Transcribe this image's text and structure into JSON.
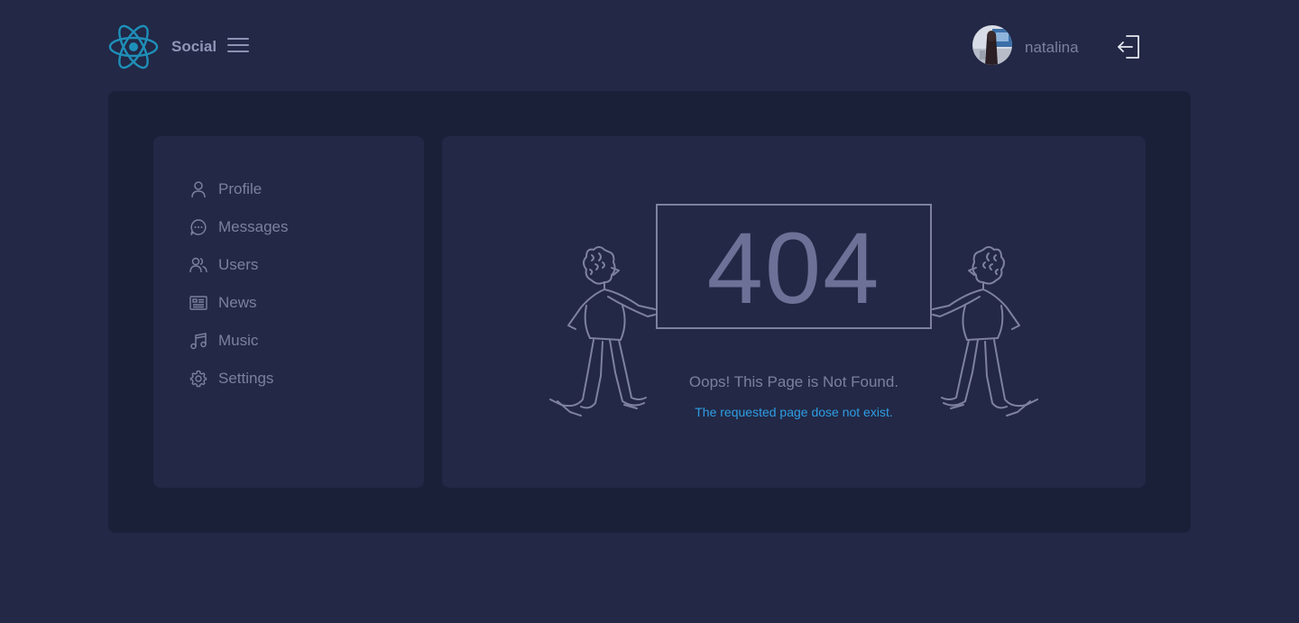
{
  "header": {
    "brand": "Social",
    "username": "natalina",
    "icons": {
      "logo": "react-atom-icon",
      "menu": "hamburger-menu-icon",
      "logout": "logout-icon"
    },
    "colors": {
      "logo": "#1e8fb8"
    }
  },
  "sidebar": {
    "items": [
      {
        "label": "Profile",
        "icon": "user-icon"
      },
      {
        "label": "Messages",
        "icon": "chat-bubble-icon"
      },
      {
        "label": "Users",
        "icon": "users-icon"
      },
      {
        "label": "News",
        "icon": "newspaper-icon"
      },
      {
        "label": "Music",
        "icon": "music-note-icon"
      },
      {
        "label": "Settings",
        "icon": "gear-icon"
      }
    ]
  },
  "error": {
    "code": "404",
    "title": "Oops! This Page is Not Found.",
    "message": "The requested page dose not exist.",
    "colors": {
      "message": "#2f9de4"
    }
  }
}
